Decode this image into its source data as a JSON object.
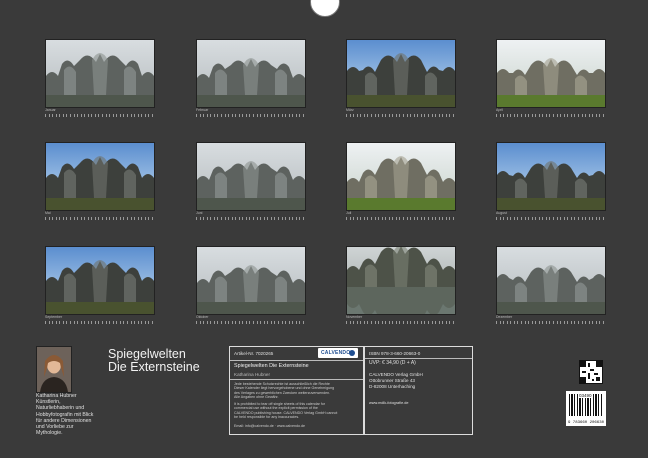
{
  "months": [
    {
      "caption": "Januar",
      "style": "grey"
    },
    {
      "caption": "Februar",
      "style": "grey"
    },
    {
      "caption": "März",
      "style": "bluesky"
    },
    {
      "caption": "April",
      "style": "green"
    },
    {
      "caption": "Mai",
      "style": "bluesky"
    },
    {
      "caption": "Juni",
      "style": "grey"
    },
    {
      "caption": "Juli",
      "style": "green"
    },
    {
      "caption": "August",
      "style": "bluesky"
    },
    {
      "caption": "September",
      "style": "bluesky"
    },
    {
      "caption": "Oktober",
      "style": "grey"
    },
    {
      "caption": "November",
      "style": "water"
    },
    {
      "caption": "Dezember",
      "style": "grey"
    }
  ],
  "author": {
    "lines": [
      "Katharina Hubner",
      "Künstlerin,",
      "Naturliebhaberin und",
      "Hobbyfotografin mit Blick",
      "für andere Dimensionen",
      "und Vorliebe zur",
      "Mythologie."
    ]
  },
  "title": {
    "line1": "Spiegelwelten",
    "line2": "Die Externsteine"
  },
  "info_left": {
    "article": "Artikel-Nr. 7020265",
    "logo": "CALVENDO",
    "title": "Spiegelwelten  Die Externsteine",
    "author": "Katharina Hubner",
    "text1": [
      "Jede bestehende Schutzrechte ist ausschließlich die Rechte",
      "Dieser Kalender liegt hervorgehobene und ohne Genehmigung",
      "des Verlages zu gewerblichen Zwecken weiterzuverwenden.",
      "Alle Angaben ohne Gewähr."
    ],
    "text2": [
      "It is prohibited to tear off single sheets of this calendar for",
      "commercial use without the explicit permission of the",
      "CALVENDO publishing house. CALVENDO Verlag GmbH cannot",
      "be held responsible for any inaccuracies."
    ],
    "contact": "Email: info@calvendo.de · www.calvendo.de"
  },
  "info_right": {
    "isbn": "ISBN 978-3-660-20663-0",
    "price": "UVP: € 34,90 (D + A)",
    "publisher": "CALVENDO Verlag GmbH",
    "street": "Ottobrunner Straße 43",
    "city": "D-82008 Unterhaching",
    "web": "www.mdlk-fotografie.de"
  },
  "barcode": {
    "number": "9 783660 206630",
    "code": "03490"
  }
}
